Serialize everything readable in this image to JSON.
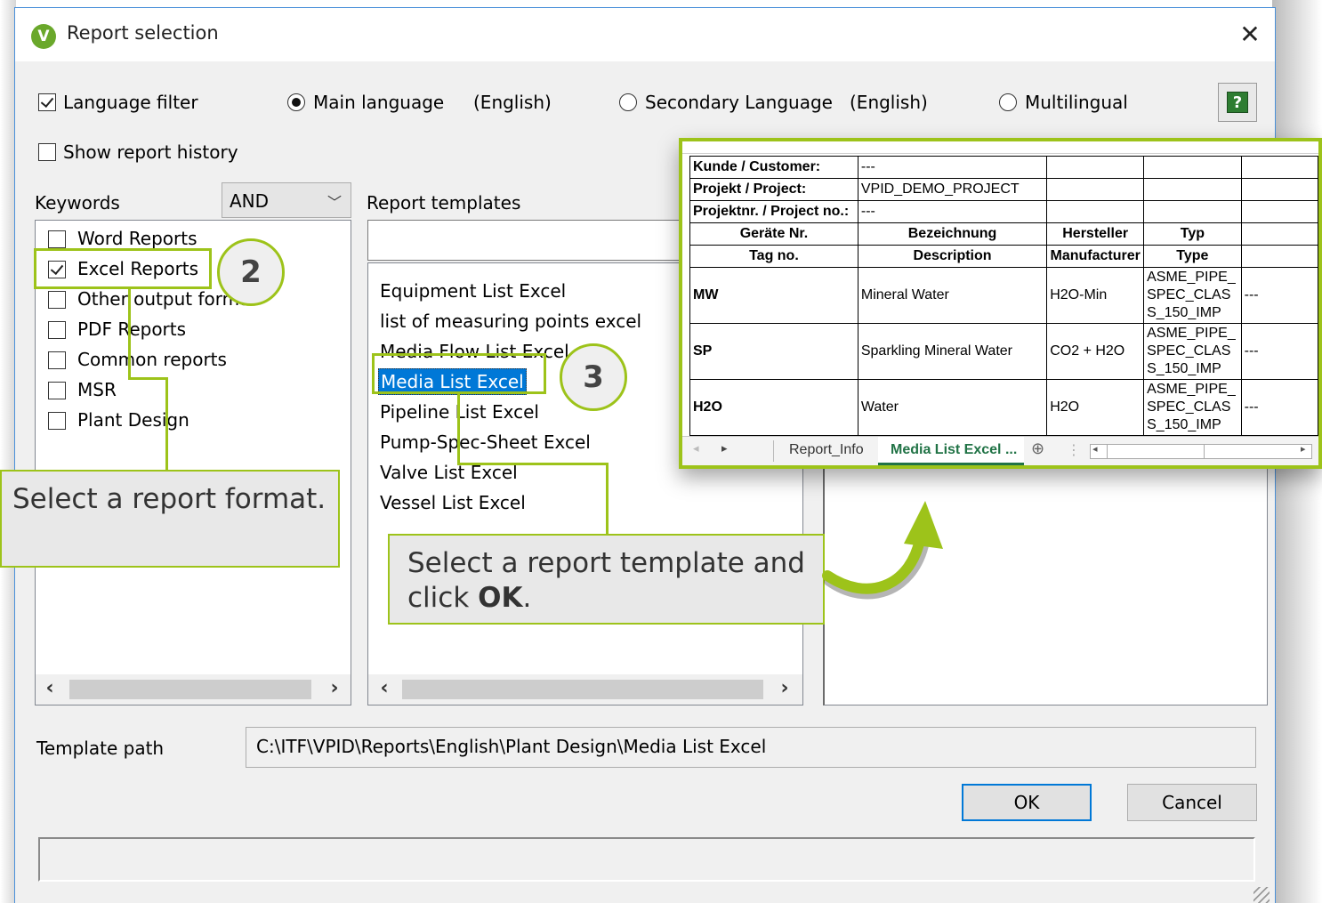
{
  "window": {
    "title": "Report selection"
  },
  "filters": {
    "language_filter_label": "Language filter",
    "main_language_label": "Main language",
    "main_language_value": "(English)",
    "secondary_language_label": "Secondary Language",
    "secondary_language_value": "(English)",
    "multilingual_label": "Multilingual",
    "show_history_label": "Show report history"
  },
  "keywords": {
    "label": "Keywords",
    "operator": "AND",
    "items": [
      "Word Reports",
      "Excel Reports",
      "Other output formats",
      "PDF Reports",
      "Common reports",
      "MSR",
      "Plant Design"
    ]
  },
  "templates": {
    "label": "Report templates",
    "items": [
      "Equipment List Excel",
      "list of measuring points excel",
      "Media Flow List Excel",
      "Media List Excel",
      "Pipeline List Excel",
      "Pump-Spec-Sheet Excel",
      "Valve List Excel",
      "Vessel List Excel"
    ]
  },
  "template_path": {
    "label": "Template path",
    "value": "C:\\ITF\\VPID\\Reports\\English\\Plant Design\\Media List Excel"
  },
  "buttons": {
    "ok": "OK",
    "cancel": "Cancel"
  },
  "callouts": {
    "step2": "2",
    "step3": "3",
    "format_text": "Select a report format.",
    "template_text_pre": "Select a report template and click ",
    "template_text_bold": "OK",
    "template_text_post": "."
  },
  "preview": {
    "customer_label": "Kunde / Customer:",
    "customer_value": "---",
    "project_label": "Projekt / Project:",
    "project_value": "VPID_DEMO_PROJECT",
    "project_no_label": "Projektnr. / Project no.:",
    "project_no_value": "---",
    "headers_de": [
      "Geräte Nr.",
      "Bezeichnung",
      "Hersteller",
      "Typ"
    ],
    "headers_en": [
      "Tag no.",
      "Description",
      "Manufacturer",
      "Type"
    ],
    "rows": [
      {
        "tag": "MW",
        "description": "Mineral Water",
        "manufacturer": "H2O-Min",
        "type": "ASME_PIPE_ SPEC_CLAS S_150_IMP",
        "extra": "---"
      },
      {
        "tag": "SP",
        "description": "Sparkling Mineral Water",
        "manufacturer": "CO2 + H2O",
        "type": "ASME_PIPE_ SPEC_CLAS S_150_IMP",
        "extra": "---"
      },
      {
        "tag": "H2O",
        "description": "Water",
        "manufacturer": "H2O",
        "type": "ASME_PIPE_ SPEC_CLAS S_150_IMP",
        "extra": "---"
      }
    ],
    "sheet_tabs": [
      "Report_Info",
      "Media List Excel ..."
    ]
  },
  "colors": {
    "accent": "#9dc31a",
    "selection": "#0078d7",
    "window_bg": "#f0f0f0"
  }
}
